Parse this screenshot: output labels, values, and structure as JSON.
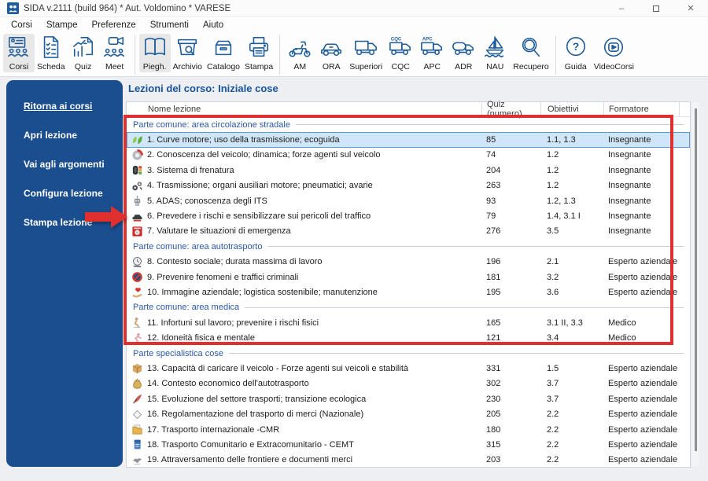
{
  "window": {
    "title": "SIDA v.2111 (build 964) * Aut. Voldomino * VARESE",
    "controls": {
      "minimize": "–",
      "close": "✕"
    }
  },
  "menu": {
    "items": [
      "Corsi",
      "Stampe",
      "Preferenze",
      "Strumenti",
      "Aiuto"
    ]
  },
  "toolbar": {
    "groups": [
      {
        "items": [
          {
            "label": "Corsi",
            "icon": "courses-icon",
            "selected": true
          },
          {
            "label": "Scheda",
            "icon": "sheet-icon",
            "selected": false
          },
          {
            "label": "Quiz",
            "icon": "quiz-chart-icon",
            "selected": false
          },
          {
            "label": "Meet",
            "icon": "video-meeting-icon",
            "selected": false
          }
        ]
      },
      {
        "items": [
          {
            "label": "Piegh.",
            "icon": "booklet-icon",
            "selected": true
          },
          {
            "label": "Archivio",
            "icon": "archive-search-icon",
            "selected": false
          },
          {
            "label": "Catalogo",
            "icon": "catalog-drawer-icon",
            "selected": false
          },
          {
            "label": "Stampa",
            "icon": "printer-icon",
            "selected": false
          }
        ]
      },
      {
        "items": [
          {
            "label": "AM",
            "icon": "scooter-icon",
            "selected": false
          },
          {
            "label": "ORA",
            "icon": "car-icon",
            "selected": false
          },
          {
            "label": "Superiori",
            "icon": "truck-icon",
            "selected": false
          },
          {
            "label": "CQC",
            "icon": "truck-cqc-icon",
            "selected": false
          },
          {
            "label": "APC",
            "icon": "truck-apc-icon",
            "selected": false
          },
          {
            "label": "ADR",
            "icon": "tanker-truck-icon",
            "selected": false
          },
          {
            "label": "NAU",
            "icon": "sailboat-icon",
            "selected": false
          },
          {
            "label": "Recupero",
            "icon": "magnifier-icon",
            "selected": false
          }
        ]
      },
      {
        "items": [
          {
            "label": "Guida",
            "icon": "help-icon",
            "selected": false
          },
          {
            "label": "VideoCorsi",
            "icon": "video-play-icon",
            "selected": false
          }
        ]
      }
    ]
  },
  "sidebar": {
    "items": [
      {
        "label": "Ritorna ai corsi",
        "underlined": true
      },
      {
        "label": "Apri lezione",
        "underlined": false
      },
      {
        "label": "Vai agli argomenti",
        "underlined": false
      },
      {
        "label": "Configura lezione",
        "underlined": false
      },
      {
        "label": "Stampa lezione",
        "underlined": false
      }
    ]
  },
  "main": {
    "title": "Lezioni del corso: Iniziale cose",
    "table": {
      "headers": [
        "Nome lezione",
        "Quiz (numero)",
        "Obiettivi",
        "Formatore"
      ],
      "rows": [
        {
          "type": "group",
          "label": "Parte comune: area circolazione stradale"
        },
        {
          "type": "lesson",
          "icon": "eco-leaves-icon",
          "name": "1. Curve motore; uso della trasmissione; ecoguida",
          "quiz": "85",
          "obiettivi": "1.1, 1.3",
          "formatore": "Insegnante",
          "selected": true
        },
        {
          "type": "lesson",
          "icon": "brake-disc-icon",
          "name": "2. Conoscenza del veicolo; dinamica; forze agenti sul veicolo",
          "quiz": "74",
          "obiettivi": "1.2",
          "formatore": "Insegnante",
          "selected": false
        },
        {
          "type": "lesson",
          "icon": "tire-trafficlight-icon",
          "name": "3. Sistema di frenatura",
          "quiz": "204",
          "obiettivi": "1.2",
          "formatore": "Insegnante",
          "selected": false
        },
        {
          "type": "lesson",
          "icon": "transmission-icon",
          "name": "4. Trasmissione; organi ausiliari motore; pneumatici; avarie",
          "quiz": "263",
          "obiettivi": "1.2",
          "formatore": "Insegnante",
          "selected": false
        },
        {
          "type": "lesson",
          "icon": "adas-robot-icon",
          "name": "5. ADAS; conoscenza degli ITS",
          "quiz": "93",
          "obiettivi": "1.2, 1.3",
          "formatore": "Insegnante",
          "selected": false
        },
        {
          "type": "lesson",
          "icon": "risk-car-icon",
          "name": "6. Prevedere i rischi e sensibilizzare sui pericoli del traffico",
          "quiz": "79",
          "obiettivi": "1.4, 3.1 I",
          "formatore": "Insegnante",
          "selected": false
        },
        {
          "type": "lesson",
          "icon": "emergency-icon",
          "name": "7. Valutare le situazioni di emergenza",
          "quiz": "276",
          "obiettivi": "3.5",
          "formatore": "Insegnante",
          "selected": false
        },
        {
          "type": "group",
          "label": "Parte comune: area autotrasporto"
        },
        {
          "type": "lesson",
          "icon": "clock-icon",
          "name": "8. Contesto sociale; durata massima di lavoro",
          "quiz": "196",
          "obiettivi": "2.1",
          "formatore": "Esperto aziendale",
          "selected": false
        },
        {
          "type": "lesson",
          "icon": "prohibition-icon",
          "name": "9. Prevenire fenomeni e traffici criminali",
          "quiz": "181",
          "obiettivi": "3.2",
          "formatore": "Esperto aziendale",
          "selected": false
        },
        {
          "type": "lesson",
          "icon": "hand-heart-icon",
          "name": "10. Immagine aziendale; logistica sostenibile; manutenzione",
          "quiz": "195",
          "obiettivi": "3.6",
          "formatore": "Esperto aziendale",
          "selected": false
        },
        {
          "type": "group",
          "label": "Parte comune: area medica"
        },
        {
          "type": "lesson",
          "icon": "injury-icon",
          "name": "11. Infortuni sul lavoro; prevenire i rischi fisici",
          "quiz": "165",
          "obiettivi": "3.1 II, 3.3",
          "formatore": "Medico",
          "selected": false
        },
        {
          "type": "lesson",
          "icon": "fitness-icon",
          "name": "12. Idoneità fisica e mentale",
          "quiz": "121",
          "obiettivi": "3.4",
          "formatore": "Medico",
          "selected": false
        },
        {
          "type": "group",
          "label": "Parte specialistica cose"
        },
        {
          "type": "lesson",
          "icon": "cargo-box-icon",
          "name": "13. Capacità di caricare il veicolo - Forze agenti sui veicoli e stabilità",
          "quiz": "331",
          "obiettivi": "1.5",
          "formatore": "Esperto aziendale",
          "selected": false
        },
        {
          "type": "lesson",
          "icon": "economy-icon",
          "name": "14. Contesto economico dell'autotrasporto",
          "quiz": "302",
          "obiettivi": "3.7",
          "formatore": "Esperto aziendale",
          "selected": false
        },
        {
          "type": "lesson",
          "icon": "quill-icon",
          "name": "15. Evoluzione del settore trasporti; transizione ecologica",
          "quiz": "230",
          "obiettivi": "3.7",
          "formatore": "Esperto aziendale",
          "selected": false
        },
        {
          "type": "lesson",
          "icon": "diamond-icon",
          "name": "16. Regolamentazione del trasporto di merci (Nazionale)",
          "quiz": "205",
          "obiettivi": "2.2",
          "formatore": "Esperto aziendale",
          "selected": false
        },
        {
          "type": "lesson",
          "icon": "folder-docs-icon",
          "name": "17. Trasporto internazionale -CMR",
          "quiz": "180",
          "obiettivi": "2.2",
          "formatore": "Esperto aziendale",
          "selected": false
        },
        {
          "type": "lesson",
          "icon": "binder-icon",
          "name": "18. Trasporto Comunitario e Extracomunitario - CEMT",
          "quiz": "315",
          "obiettivi": "2.2",
          "formatore": "Esperto aziendale",
          "selected": false
        },
        {
          "type": "lesson",
          "icon": "bird-icon",
          "name": "19. Attraversamento delle frontiere e documenti merci",
          "quiz": "203",
          "obiettivi": "2.2",
          "formatore": "Esperto aziendale",
          "selected": false
        }
      ]
    }
  },
  "colors": {
    "accent_blue": "#1e5c9a",
    "sidebar_blue": "#1b4e8e",
    "title_blue": "#17539b",
    "selected_row_bg": "#cfe5f8",
    "selected_row_border": "#5b9bd5",
    "annotation_red": "#e02f2f"
  }
}
